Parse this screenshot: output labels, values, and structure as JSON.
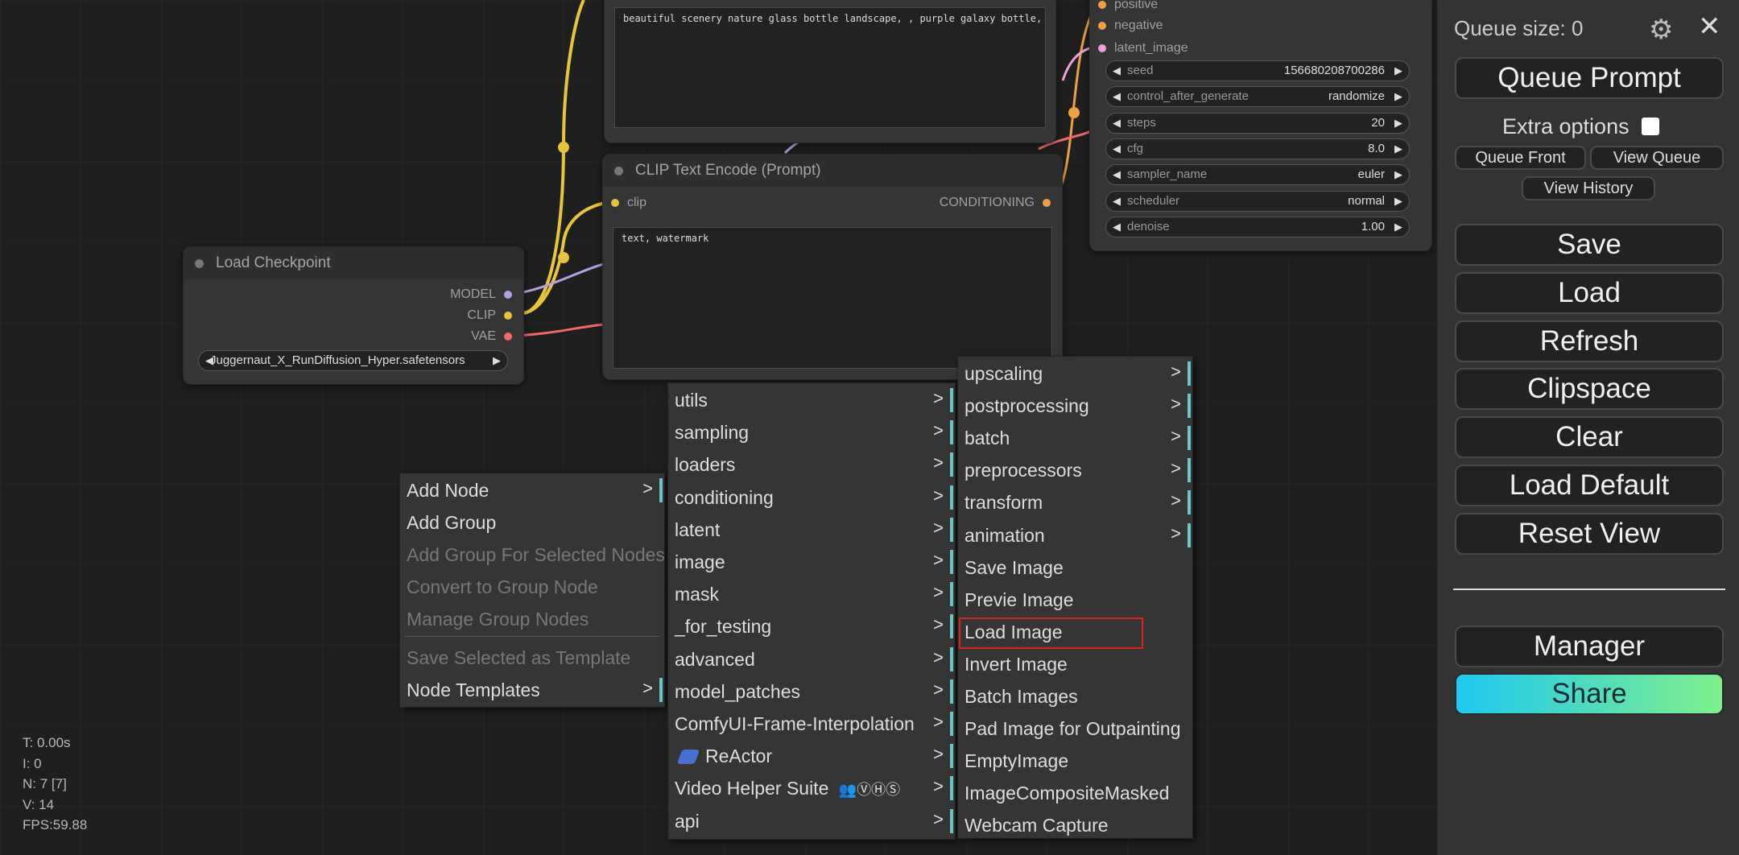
{
  "canvas": {
    "positive_prompt": "beautiful scenery nature glass bottle landscape, , purple galaxy bottle,",
    "clip_node": {
      "title": "CLIP Text Encode (Prompt)",
      "input": "clip",
      "output": "CONDITIONING",
      "text": "text, watermark"
    },
    "checkpoint_node": {
      "title": "Load Checkpoint",
      "outputs": [
        "MODEL",
        "CLIP",
        "VAE"
      ],
      "ckpt_name": "Juggernaut_X_RunDiffusion_Hyper.safetensors"
    },
    "ksampler": {
      "inputs": [
        "positive",
        "negative",
        "latent_image"
      ],
      "widgets": [
        {
          "name": "seed",
          "value": "156680208700286"
        },
        {
          "name": "control_after_generate",
          "value": "randomize"
        },
        {
          "name": "steps",
          "value": "20"
        },
        {
          "name": "cfg",
          "value": "8.0"
        },
        {
          "name": "sampler_name",
          "value": "euler"
        },
        {
          "name": "scheduler",
          "value": "normal"
        },
        {
          "name": "denoise",
          "value": "1.00"
        }
      ]
    }
  },
  "context_menu": {
    "items": [
      {
        "label": "Add Node",
        "submenu": true,
        "enabled": true
      },
      {
        "label": "Add Group",
        "submenu": false,
        "enabled": true
      },
      {
        "label": "Add Group For Selected Nodes",
        "submenu": false,
        "enabled": false
      },
      {
        "label": "Convert to Group Node",
        "submenu": false,
        "enabled": false
      },
      {
        "label": "Manage Group Nodes",
        "submenu": false,
        "enabled": false
      },
      {
        "label": "Save Selected as Template",
        "submenu": false,
        "enabled": false
      },
      {
        "label": "Node Templates",
        "submenu": true,
        "enabled": true
      }
    ]
  },
  "add_node_menu": {
    "items": [
      "utils",
      "sampling",
      "loaders",
      "conditioning",
      "latent",
      "image",
      "mask",
      "_for_testing",
      "advanced",
      "model_patches",
      "ComfyUI-Frame-Interpolation",
      "ReActor",
      "Video Helper Suite",
      "api"
    ],
    "vhs_badge": "ⓋⒽⓈ"
  },
  "image_menu": {
    "items": [
      {
        "label": "upscaling",
        "submenu": true
      },
      {
        "label": "postprocessing",
        "submenu": true
      },
      {
        "label": "batch",
        "submenu": true
      },
      {
        "label": "preprocessors",
        "submenu": true
      },
      {
        "label": "transform",
        "submenu": true
      },
      {
        "label": "animation",
        "submenu": true
      },
      {
        "label": "Save Image",
        "submenu": false
      },
      {
        "label": "Previe  Image",
        "submenu": false
      },
      {
        "label": "Load Image",
        "submenu": false,
        "highlighted": true
      },
      {
        "label": "Invert Image",
        "submenu": false
      },
      {
        "label": "Batch Images",
        "submenu": false
      },
      {
        "label": "Pad Image for Outpainting",
        "submenu": false
      },
      {
        "label": "EmptyImage",
        "submenu": false
      },
      {
        "label": "ImageCompositeMasked",
        "submenu": false
      },
      {
        "label": "Webcam Capture",
        "submenu": false
      }
    ]
  },
  "stats": {
    "t": "T: 0.00s",
    "i": "I: 0",
    "n": "N: 7 [7]",
    "v": "V: 14",
    "fps": "FPS:59.88"
  },
  "panel": {
    "queue_size": "Queue size: 0",
    "queue_prompt": "Queue Prompt",
    "extra_options": "Extra options",
    "queue_front": "Queue Front",
    "view_queue": "View Queue",
    "view_history": "View History",
    "buttons": [
      "Save",
      "Load",
      "Refresh",
      "Clipspace",
      "Clear",
      "Load Default",
      "Reset View"
    ],
    "manager": "Manager",
    "share": "Share"
  },
  "colors": {
    "clip_slot": "#e8c43a",
    "model_slot": "#b4a0e0",
    "vae_slot": "#f06a6a",
    "latent_slot": "#f0a0d8",
    "cond_slot": "#f0a040",
    "menu_bar": "#6cc7c7",
    "highlight": "#dd2222"
  }
}
